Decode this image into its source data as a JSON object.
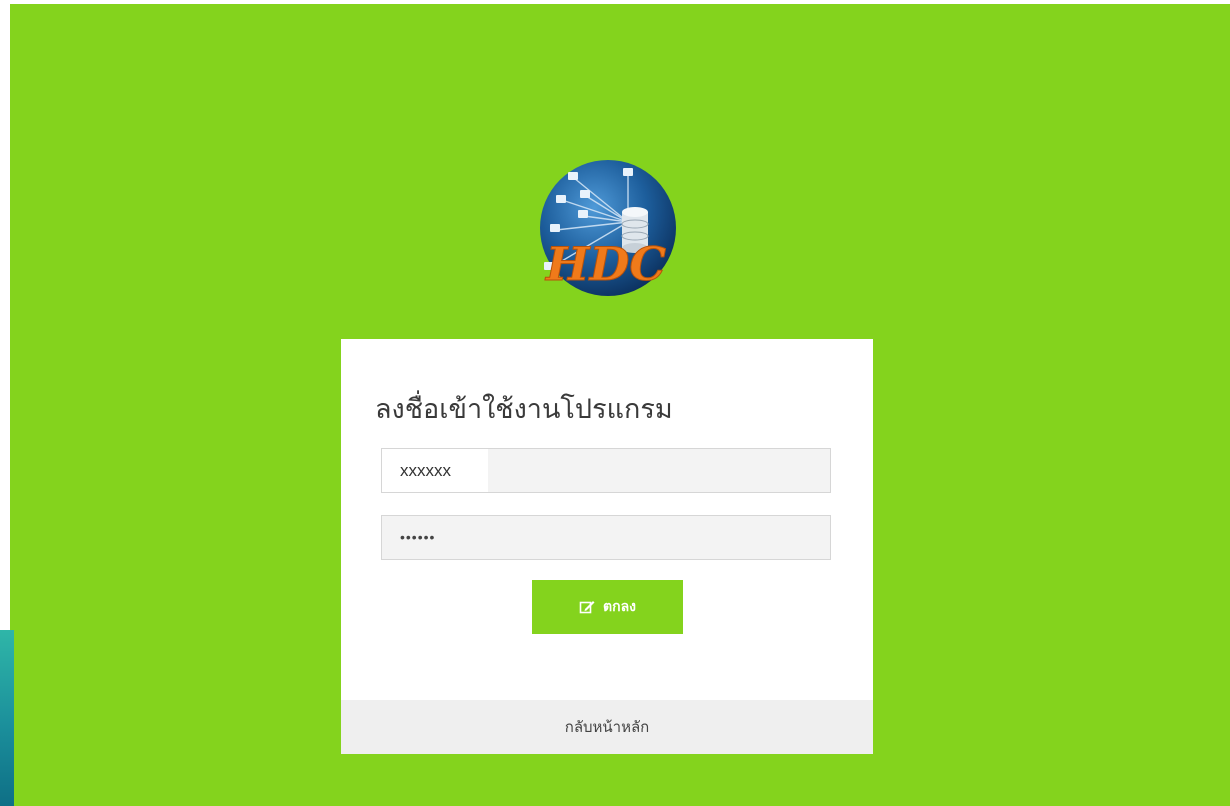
{
  "logo": {
    "text": "HDC",
    "icon": "globe-network-database-icon"
  },
  "login": {
    "title": "ลงชื่อเข้าใช้งานโปรแกรม",
    "username_value": "xxxxxx",
    "password_value": "••••••",
    "submit_label": "ตกลง",
    "submit_icon": "edit-icon",
    "back_link": "กลับหน้าหลัก"
  },
  "colors": {
    "background": "#84d31d",
    "panel": "#ffffff",
    "button": "#84d31d",
    "footer": "#efefef"
  }
}
